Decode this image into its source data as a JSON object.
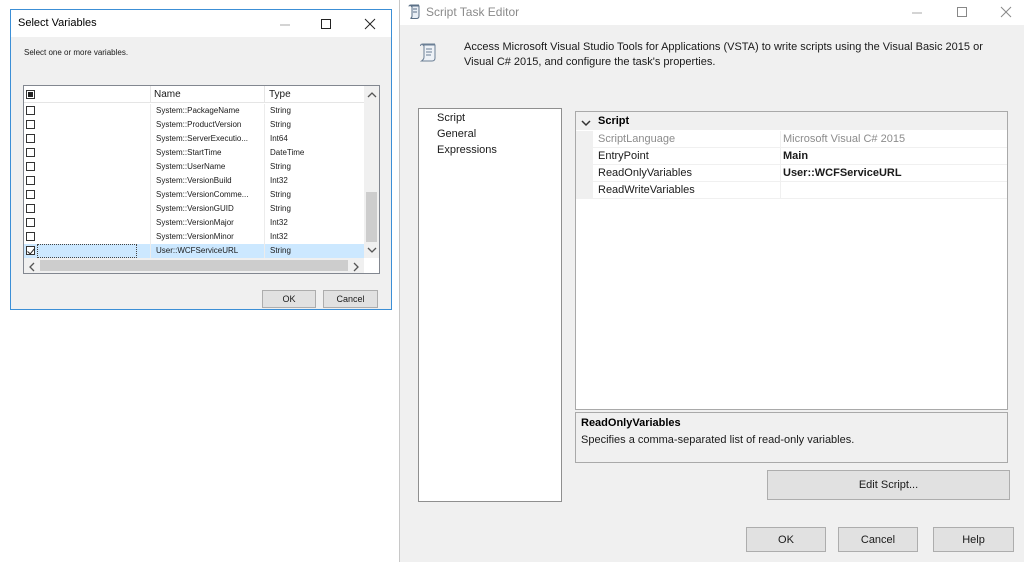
{
  "script_task_editor": {
    "title": "Script Task Editor",
    "description": "Access Microsoft Visual Studio Tools for Applications (VSTA) to write scripts using the Visual Basic 2015 or Visual C# 2015, and configure the task's properties.",
    "nav": [
      "Script",
      "General",
      "Expressions"
    ],
    "properties": {
      "category": "Script",
      "rows": [
        {
          "name": "ScriptLanguage",
          "value": "Microsoft Visual C# 2015"
        },
        {
          "name": "EntryPoint",
          "value": "Main"
        },
        {
          "name": "ReadOnlyVariables",
          "value": "User::WCFServiceURL"
        },
        {
          "name": "ReadWriteVariables",
          "value": ""
        }
      ]
    },
    "help": {
      "title": "ReadOnlyVariables",
      "text": "Specifies a comma-separated list of read-only variables."
    },
    "buttons": {
      "edit_script": "Edit Script...",
      "ok": "OK",
      "cancel": "Cancel",
      "help": "Help"
    }
  },
  "select_variables": {
    "title": "Select Variables",
    "instruction": "Select one or more variables.",
    "columns": [
      "Name",
      "Type"
    ],
    "rows": [
      {
        "name": "System::PackageName",
        "type": "String",
        "checked": false
      },
      {
        "name": "System::ProductVersion",
        "type": "String",
        "checked": false
      },
      {
        "name": "System::ServerExecutio...",
        "type": "Int64",
        "checked": false
      },
      {
        "name": "System::StartTime",
        "type": "DateTime",
        "checked": false
      },
      {
        "name": "System::UserName",
        "type": "String",
        "checked": false
      },
      {
        "name": "System::VersionBuild",
        "type": "Int32",
        "checked": false
      },
      {
        "name": "System::VersionComme...",
        "type": "String",
        "checked": false
      },
      {
        "name": "System::VersionGUID",
        "type": "String",
        "checked": false
      },
      {
        "name": "System::VersionMajor",
        "type": "Int32",
        "checked": false
      },
      {
        "name": "System::VersionMinor",
        "type": "Int32",
        "checked": false
      },
      {
        "name": "User::WCFServiceURL",
        "type": "String",
        "checked": true
      }
    ],
    "buttons": {
      "ok": "OK",
      "cancel": "Cancel"
    }
  }
}
